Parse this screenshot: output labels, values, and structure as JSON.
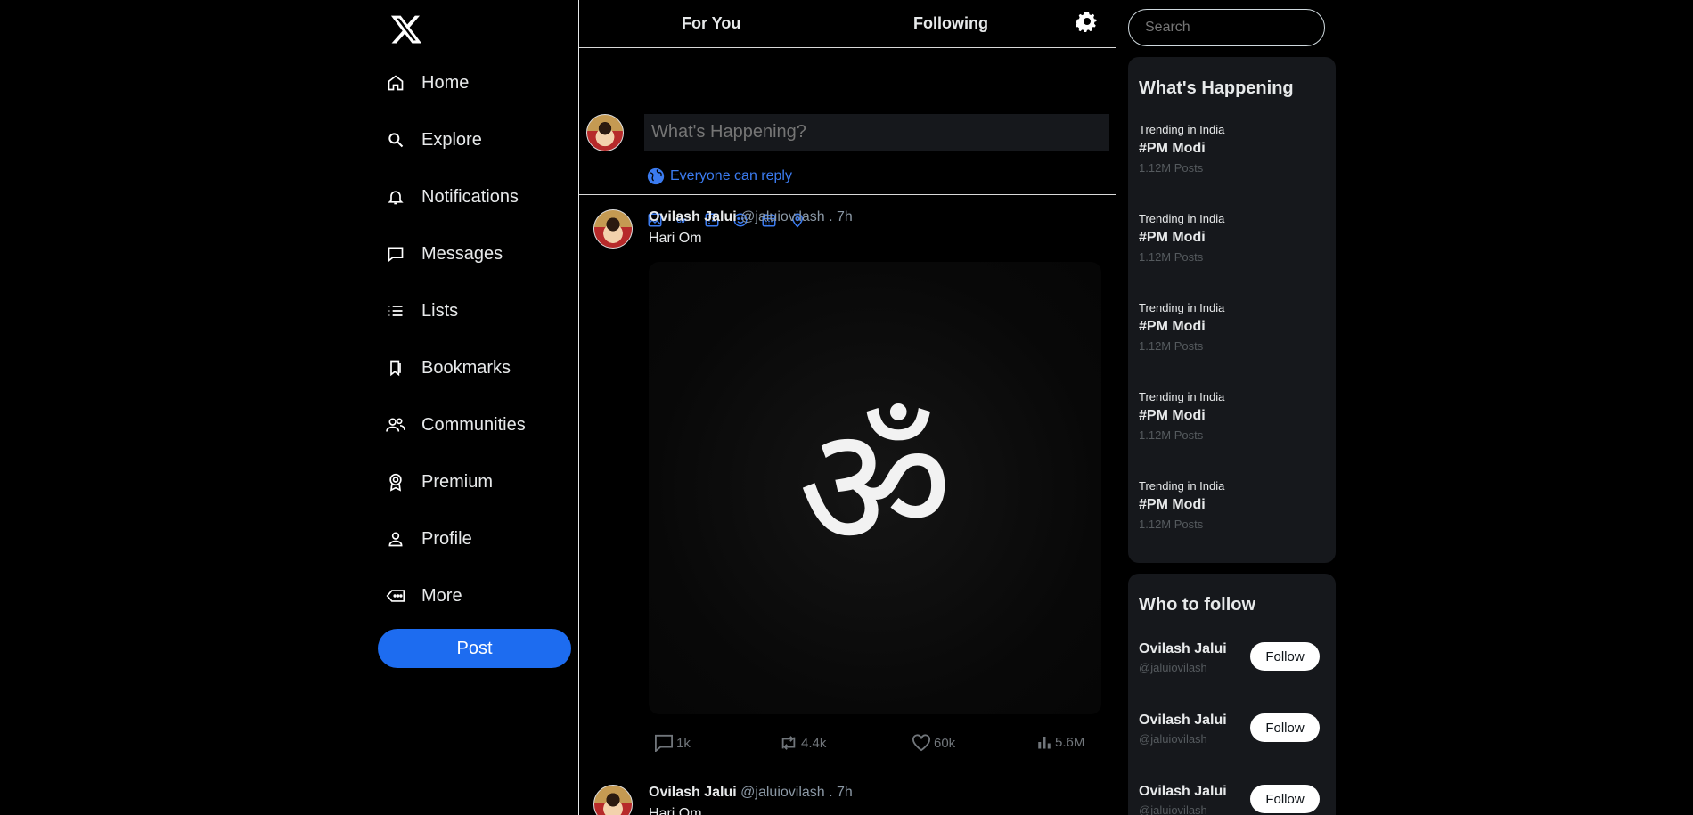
{
  "nav": {
    "items": [
      {
        "label": "Home",
        "icon": "home-icon"
      },
      {
        "label": "Explore",
        "icon": "search-icon"
      },
      {
        "label": "Notifications",
        "icon": "bell-icon"
      },
      {
        "label": "Messages",
        "icon": "message-icon"
      },
      {
        "label": "Lists",
        "icon": "list-icon"
      },
      {
        "label": "Bookmarks",
        "icon": "bookmark-icon"
      },
      {
        "label": "Communities",
        "icon": "people-icon"
      },
      {
        "label": "Premium",
        "icon": "badge-icon"
      },
      {
        "label": "Profile",
        "icon": "user-icon"
      },
      {
        "label": "More",
        "icon": "more-icon"
      }
    ],
    "post_label": "Post"
  },
  "tabs": {
    "for_you": "For You",
    "following": "Following"
  },
  "composer": {
    "placeholder": "What's Happening?",
    "reply_setting": "Everyone can reply"
  },
  "tweets": [
    {
      "name": "Ovilash Jalui",
      "handle": "@jaluiovilash . 7h",
      "text": "Hari Om",
      "media_glyph": "ॐ",
      "replies": "1k",
      "reposts": "4.4k",
      "likes": "60k",
      "views": "5.6M"
    },
    {
      "name": "Ovilash Jalui",
      "handle": "@jaluiovilash . 7h",
      "text": "Hari Om"
    }
  ],
  "search": {
    "placeholder": "Search"
  },
  "whats_happening": {
    "title": "What's Happening",
    "trends": [
      {
        "category": "Trending in India",
        "tag": "#PM Modi",
        "count": "1.12M Posts"
      },
      {
        "category": "Trending in India",
        "tag": "#PM Modi",
        "count": "1.12M Posts"
      },
      {
        "category": "Trending in India",
        "tag": "#PM Modi",
        "count": "1.12M Posts"
      },
      {
        "category": "Trending in India",
        "tag": "#PM Modi",
        "count": "1.12M Posts"
      },
      {
        "category": "Trending in India",
        "tag": "#PM Modi",
        "count": "1.12M Posts"
      }
    ]
  },
  "who_to_follow": {
    "title": "Who to follow",
    "follow_label": "Follow",
    "users": [
      {
        "name": "Ovilash Jalui",
        "handle": "@jaluiovilash"
      },
      {
        "name": "Ovilash Jalui",
        "handle": "@jaluiovilash"
      },
      {
        "name": "Ovilash Jalui",
        "handle": "@jaluiovilash"
      }
    ]
  },
  "colors": {
    "accent": "#1d6cf0",
    "link": "#3b7bf0",
    "panel": "#16181c"
  }
}
